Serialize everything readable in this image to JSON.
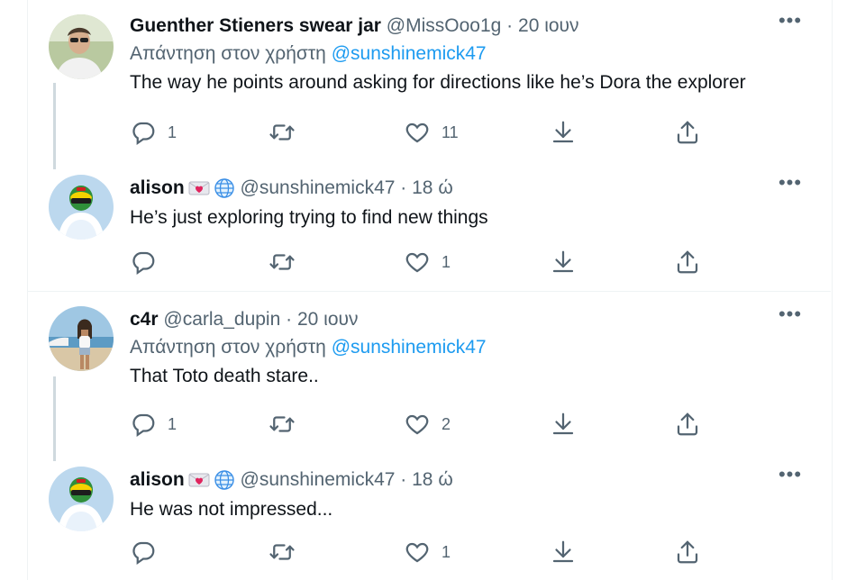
{
  "tweets": [
    {
      "name": "Guenther Stieners swear jar",
      "handle": "@MissOoo1g",
      "dot": "·",
      "time": "20 ιουν",
      "replying_prefix": "Απάντηση στον χρήστη",
      "replying_to": "@sunshinemick47",
      "text": "The way he points around asking for directions like he’s Dora the explorer",
      "replies": "1",
      "retweets": "",
      "likes": "11",
      "avatar": "man-with-glasses-avatar"
    },
    {
      "name": "alison",
      "handle": "@sunshinemick47",
      "dot": "·",
      "time": "18 ώ",
      "emojis": [
        "love-letter-emoji",
        "globe-emoji"
      ],
      "text": "He’s just exploring trying to find new things",
      "replies": "",
      "retweets": "",
      "likes": "1",
      "avatar": "helmet-and-dress-avatar"
    },
    {
      "name": "c4r",
      "handle": "@carla_dupin",
      "dot": "·",
      "time": "20 ιουν",
      "replying_prefix": "Απάντηση στον χρήστη",
      "replying_to": "@sunshinemick47",
      "text": "That Toto death stare..",
      "replies": "1",
      "retweets": "",
      "likes": "2",
      "avatar": "woman-on-beach-avatar"
    },
    {
      "name": "alison",
      "handle": "@sunshinemick47",
      "dot": "·",
      "time": "18 ώ",
      "emojis": [
        "love-letter-emoji",
        "globe-emoji"
      ],
      "text": "He was not impressed...",
      "replies": "",
      "retweets": "",
      "likes": "1",
      "avatar": "helmet-and-dress-avatar"
    }
  ],
  "more_label": "•••",
  "colors": {
    "text": "#0f1419",
    "secondary": "#536471",
    "link": "#1d9bf0",
    "border": "#eff3f4",
    "thread": "#cfd9de"
  }
}
